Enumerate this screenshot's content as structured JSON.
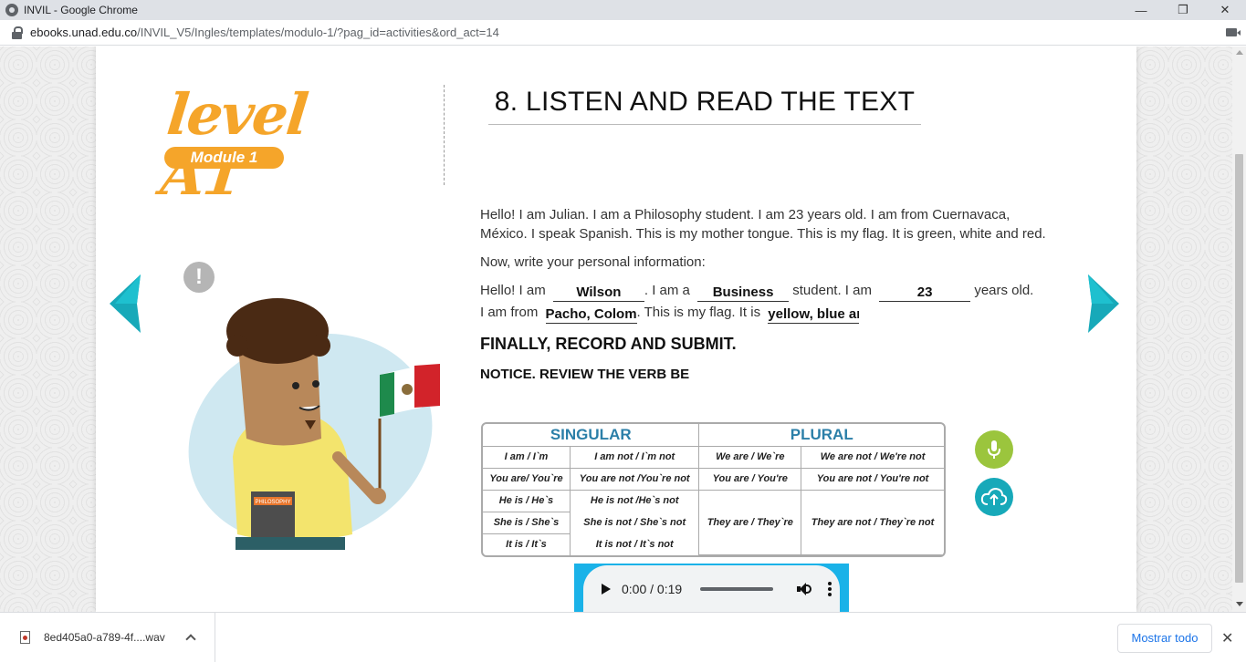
{
  "browser": {
    "window_title": "INVIL - Google Chrome",
    "controls": {
      "minimize": "—",
      "restore": "❐",
      "close": "✕"
    },
    "url_domain": "ebooks.unad.edu.co",
    "url_path": "/INVIL_V5/Ingles/templates/modulo-1/?pag_id=activities&ord_act=14"
  },
  "header": {
    "level_text": "level A1",
    "module_badge": "Module 1",
    "title": "8. LISTEN AND READ THE TEXT"
  },
  "illustration": {
    "alert": "!",
    "book_label": "PHILOSOPHY"
  },
  "content": {
    "paragraph1": "Hello! I am Julian. I am a Philosophy student. I am 23 years old. I am from Cuernavaca, México. I speak Spanish. This is my mother tongue. This is my flag. It is green, white and red.",
    "paragraph2": "Now, write your personal information:",
    "fill": {
      "t1": "Hello! I am",
      "name": "Wilson",
      "t2": ". I am a",
      "career": "Business",
      "t3": "student. I am",
      "age": "23",
      "t4": "years old.",
      "t5": "I am from",
      "country": "Pacho, Colom",
      "t6": ". This is my flag. It is",
      "flag": "yellow, blue ar"
    },
    "heading_record": "FINALLY, RECORD AND SUBMIT.",
    "heading_notice": "NOTICE. REVIEW THE VERB BE"
  },
  "verb_table": {
    "singular": "SINGULAR",
    "plural": "PLURAL",
    "rows": [
      [
        "I am / I`m",
        "I am not / I`m not",
        "We are / We`re",
        "We are not / We're not"
      ],
      [
        "You are/  You`re",
        "You are not /You`re not",
        "You are / You're",
        "You are not / You're not"
      ],
      [
        "He is / He`s",
        "He is not /He`s not"
      ],
      [
        "She is / She`s",
        "She is not / She`s not",
        "They are / They`re",
        "They are not / They`re not"
      ],
      [
        "It is / It`s",
        "It is not / It`s not"
      ]
    ]
  },
  "audio": {
    "time": "0:00 / 0:19",
    "progress": 0
  },
  "downloads": {
    "file_name": "8ed405a0-a789-4f....wav",
    "show_all": "Mostrar todo",
    "close": "✕"
  },
  "colors": {
    "accent_orange": "#f5a52a",
    "teal": "#17a9b9",
    "mic_green": "#9bc53d",
    "table_header_blue": "#2b7fa8",
    "audio_frame_blue": "#1ab2e8"
  }
}
